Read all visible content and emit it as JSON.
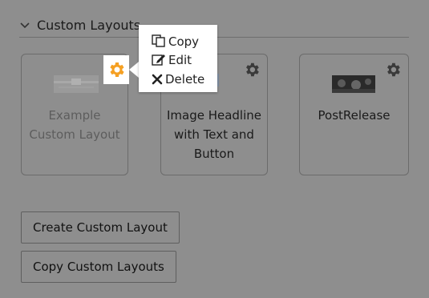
{
  "section": {
    "title": "Custom Layouts"
  },
  "cards": [
    {
      "title_line1": "Example",
      "title_line2": "Custom Layout",
      "title_line3": ""
    },
    {
      "title_line1": "Image Headline",
      "title_line2": "with Text and",
      "title_line3": "Button"
    },
    {
      "title_line1": "PostRelease",
      "title_line2": "",
      "title_line3": ""
    }
  ],
  "buttons": {
    "create_label": "Create Custom Layout",
    "copy_label": "Copy Custom Layouts"
  },
  "menu": {
    "copy_label": "Copy",
    "edit_label": "Edit",
    "delete_label": "Delete"
  },
  "icons": {
    "section_toggle": "chevron-down-icon",
    "card_settings": "gear-icon",
    "menu_copy": "copy-icon",
    "menu_edit": "edit-icon",
    "menu_delete": "close-icon"
  },
  "colors": {
    "overlay_bg": "#8e8e8e",
    "active_gear": "#f5a023",
    "menu_bg": "#ffffff"
  }
}
